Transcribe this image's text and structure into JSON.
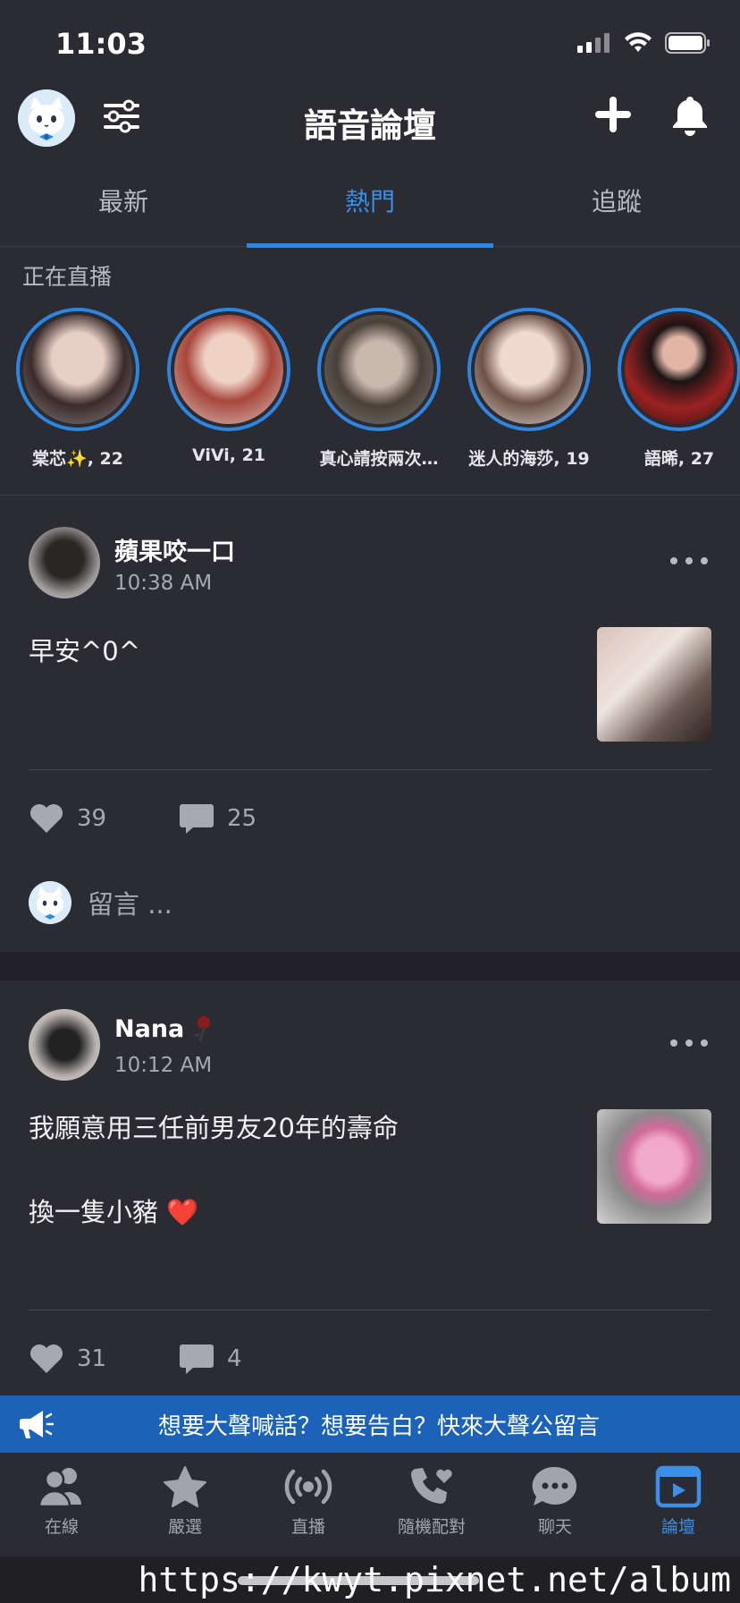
{
  "status_bar": {
    "time": "11:03"
  },
  "header": {
    "title": "語音論壇"
  },
  "tabs": [
    {
      "label": "最新",
      "active": false
    },
    {
      "label": "熱門",
      "active": true
    },
    {
      "label": "追蹤",
      "active": false
    }
  ],
  "live": {
    "title": "正在直播",
    "items": [
      {
        "name": "棠芯✨, 22",
        "color": "#9a8f8f"
      },
      {
        "name": "ViVi, 21",
        "color": "#b9968e"
      },
      {
        "name": "真心請按兩次…",
        "color": "#8d8c8a"
      },
      {
        "name": "迷人的海莎, 19",
        "color": "#c9b6ad"
      },
      {
        "name": "語晞, 27",
        "color": "#6b1e1e"
      }
    ]
  },
  "posts": [
    {
      "user": "蘋果咬一口",
      "time": "10:38 AM",
      "text": "早安^0^",
      "likes": "39",
      "comments": "25",
      "comment_placeholder": "留言 ..."
    },
    {
      "user": "Nana",
      "time": "10:12 AM",
      "text": "我願意用三任前男友20年的壽命\n\n換一隻小豬 ❤️",
      "likes": "31",
      "comments": "4"
    }
  ],
  "banner": {
    "text": "想要大聲喊話？想要告白？快來大聲公留言"
  },
  "bottom_nav": [
    {
      "label": "在線",
      "icon": "users-icon",
      "active": false
    },
    {
      "label": "嚴選",
      "icon": "star-icon",
      "active": false
    },
    {
      "label": "直播",
      "icon": "broadcast-icon",
      "active": false
    },
    {
      "label": "隨機配對",
      "icon": "phone-heart-icon",
      "active": false
    },
    {
      "label": "聊天",
      "icon": "chat-icon",
      "active": false
    },
    {
      "label": "論壇",
      "icon": "forum-icon",
      "active": true
    }
  ],
  "watermark": "https://kwyt.pixnet.net/album",
  "colors": {
    "background": "#2b2b33",
    "accent": "#2e86de",
    "banner": "#1c62b8"
  }
}
